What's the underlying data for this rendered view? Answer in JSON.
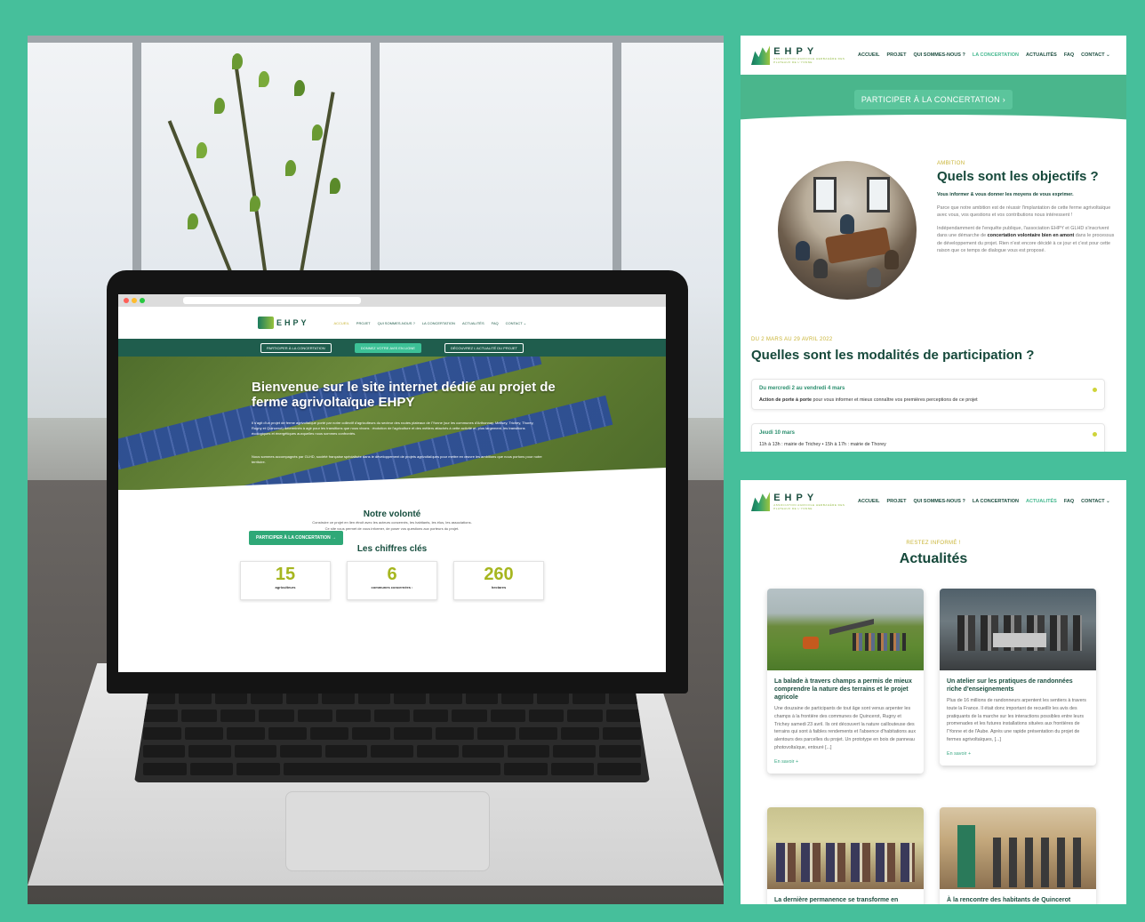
{
  "laptop_site": {
    "logo": "EHPY",
    "nav": [
      "ACCUEIL",
      "PROJET",
      "QUI SOMMES-NOUS ?",
      "LA CONCERTATION",
      "ACTUALITÉS",
      "FAQ",
      "CONTACT ⌄"
    ],
    "cta": [
      "PARTICIPER À LA CONCERTATION",
      "DONNEZ VOTRE AVIS EN LIGNE",
      "DÉCOUVREZ L'ACTUALITÉ DU PROJET"
    ],
    "hero_title": "Bienvenue sur le site internet dédié au projet de ferme agrivoltaïque EHPY",
    "hero_p1": "Il s'agit d'un projet de ferme agrivoltaïque porté par notre collectif d'agriculteurs du secteur des routes plateaux de l'Yonne (sur les communes d'Arthonnay, Melisey, Trichey, Thorey, Rugny et Quincerot) déterminés à agir pour les transitions que nous vivons : évolution de l'agriculture et des métiers attachés à cette activité et, plus largement, les transitions écologiques et énergétiques auxquelles nous sommes confrontés.",
    "hero_p2": "Nous sommes accompagnés par GLHD, société française spécialisée dans le développement de projets agrivoltaïques pour mettre en œuvre les ambitions que nous portons pour notre territoire.",
    "hero_button": "PARTICIPER À LA CONCERTATION →",
    "volonte_title": "Notre volonté",
    "volonte_text1": "Construire ce projet en lien étroit avec les acteurs concernés, les habitants, les élus, les associations.",
    "volonte_text2": "Ce site vous permet de vous informer, de poser vos questions aux porteurs du projet.",
    "chiffres_title": "Les chiffres clés",
    "figures": [
      {
        "value": "15",
        "label": "agriculteurs"
      },
      {
        "value": "6",
        "label": "communes concernées :"
      },
      {
        "value": "260",
        "label": "hectares"
      }
    ]
  },
  "shot1": {
    "logo": "EHPY",
    "logo_sub": "ASSOCIATION AGRICOLE HERBAGÈRE DES PLATEAUX DE L'YONNE",
    "nav": [
      "ACCUEIL",
      "PROJET",
      "QUI SOMMES-NOUS ?",
      "LA CONCERTATION",
      "ACTUALITÉS",
      "FAQ",
      "CONTACT ⌄"
    ],
    "active_nav": "LA CONCERTATION",
    "band_button": "PARTICIPER À LA CONCERTATION  ›",
    "eyebrow": "AMBITION",
    "title": "Quels sont les objectifs ?",
    "lead": "Vous informer & vous donner les moyens de vous exprimer.",
    "p1": "Parce que notre ambition est de réussir l'implantation de cette ferme agrivoltaïque avec vous, vos questions et vos contributions nous intéressent !",
    "p2a": "Indépendamment de l'enquête publique, l'association EHPY et GLHD s'inscrivent dans une démarche de ",
    "p2b": "concertation volontaire bien en amont",
    "p2c": " dans le processus de développement du projet. Rien n'est encore décidé à ce jour et c'est pour cette raison que ce temps de dialogue vous est proposé.",
    "dates_eyebrow": "DU 2 MARS AU 29 AVRIL 2022",
    "modalites_title": "Quelles sont les modalités de participation ?",
    "items": [
      {
        "title": "Du mercredi 2 au vendredi 4 mars",
        "desc_bold": "Action de porte à porte",
        "desc": " pour vous informer et mieux connaître vos premières perceptions de ce projet"
      },
      {
        "title": "Jeudi 10 mars",
        "desc_bold": "",
        "desc": "11h à 13h : mairie de Trichey • 15h à 17h : mairie de Thorey"
      }
    ]
  },
  "shot2": {
    "logo": "EHPY",
    "nav": [
      "ACCUEIL",
      "PROJET",
      "QUI SOMMES-NOUS ?",
      "LA CONCERTATION",
      "ACTUALITÉS",
      "FAQ",
      "CONTACT ⌄"
    ],
    "active_nav": "ACTUALITÉS",
    "eyebrow": "RESTEZ INFORMÉ !",
    "title": "Actualités",
    "cards": [
      {
        "title": "La balade à travers champs a permis de mieux comprendre la nature des terrains et le projet agricole",
        "text": "Une douzaine de participants de tout âge sont venus arpenter les champs à la frontière des communes de Quincerot, Rugny et Trichey samedi 23 avril. Ils ont découvert la nature caillouteuse des terrains qui sont à faibles rendements et l'absence d'habitations aux alentours des parcelles du projet. Un prototype en bois de panneau photovoltaïque, entouré [...]",
        "link": "En savoir +"
      },
      {
        "title": "Un atelier sur les pratiques de randonnées riche d'enseignements",
        "text": "Plus de 16 millions de randonneurs arpentent les sentiers à travers toute la France. Il était donc important de recueillir les avis des pratiquants de la marche sur les interactions possibles entre leurs promenades et les futures installations situées aux frontières de l'Yonne et de l'Aube. Après une rapide présentation du projet de fermes agrivoltaïques, [...]",
        "link": "En savoir +"
      },
      {
        "title": "La dernière permanence se transforme en",
        "text": "",
        "link": ""
      },
      {
        "title": "À la rencontre des habitants de Quincerot",
        "text": "",
        "link": ""
      }
    ]
  },
  "colors": {
    "background": "#46bf9b",
    "brand_dark": "#15483a",
    "accent_green": "#4ab68c",
    "accent_yellow": "#a6b61f"
  }
}
